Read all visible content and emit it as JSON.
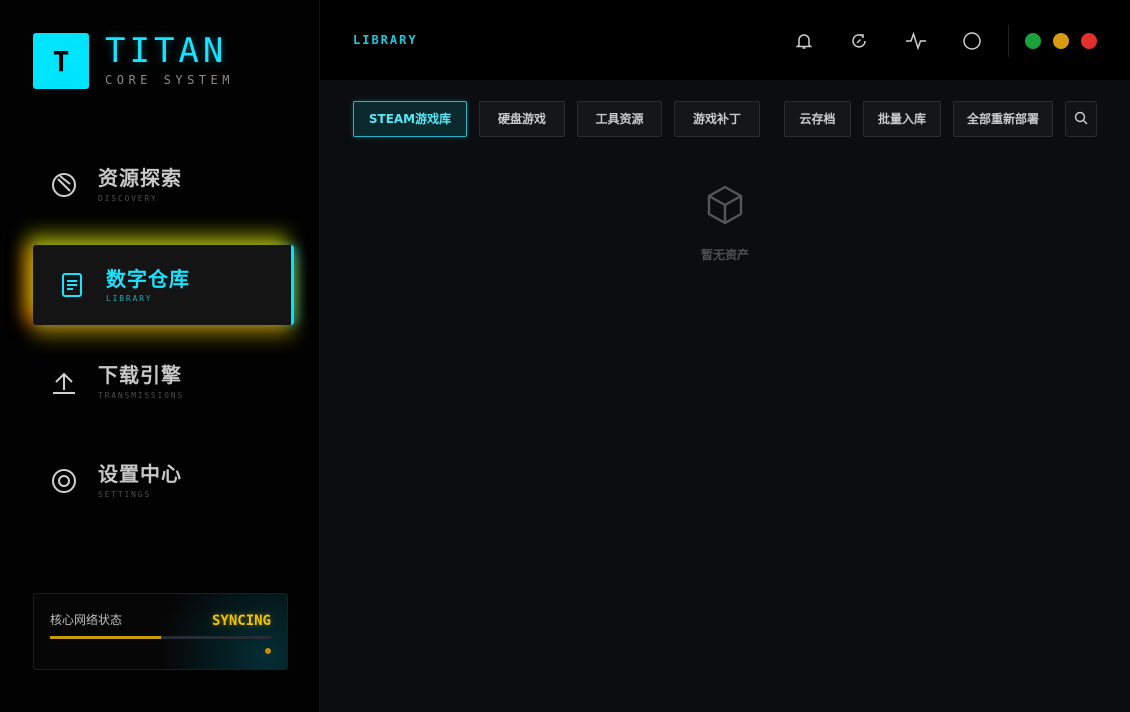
{
  "brand": {
    "logo_letter": "T",
    "title": "TITAN",
    "subtitle": "CORE SYSTEM",
    "accent_color": "#00e5ff"
  },
  "sidebar": {
    "items": [
      {
        "label": "资源探索",
        "sublabel": "DISCOVERY",
        "icon": "compass-icon"
      },
      {
        "label": "数字仓库",
        "sublabel": "LIBRARY",
        "icon": "document-icon",
        "active": true
      },
      {
        "label": "下载引擎",
        "sublabel": "TRANSMISSIONS",
        "icon": "upload-icon"
      },
      {
        "label": "设置中心",
        "sublabel": "SETTINGS",
        "icon": "settings-ring-icon"
      }
    ]
  },
  "status": {
    "label": "核心网络状态",
    "value": "SYNCING",
    "progress_percent": 50,
    "value_color": "#f2c400"
  },
  "header": {
    "title": "LIBRARY",
    "icons": [
      "bell-icon",
      "refresh-icon",
      "activity-icon",
      "circle-icon"
    ],
    "window_controls": [
      {
        "name": "green",
        "color": "#1aa23a"
      },
      {
        "name": "yellow",
        "color": "#d89a10"
      },
      {
        "name": "red",
        "color": "#e2302c"
      }
    ]
  },
  "tabs": [
    {
      "label": "STEAM游戏库",
      "active": true
    },
    {
      "label": "硬盘游戏"
    },
    {
      "label": "工具资源"
    },
    {
      "label": "游戏补丁"
    },
    {
      "label": "云存档"
    },
    {
      "label": "批量入库"
    },
    {
      "label": "全部重新部署"
    }
  ],
  "empty_state": {
    "icon": "box-icon",
    "text": "暂无资产"
  }
}
